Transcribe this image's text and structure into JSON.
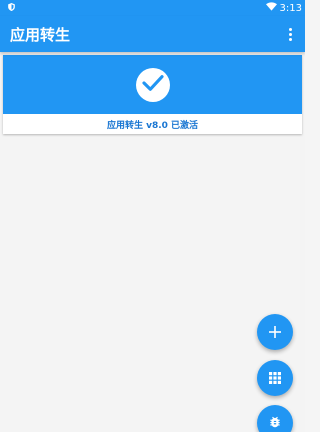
{
  "statusbar": {
    "time": "3:13"
  },
  "toolbar": {
    "title": "应用转生"
  },
  "card": {
    "status_text": "应用转生 v8.0 已激活"
  },
  "colors": {
    "primary": "#2196f3",
    "status_text": "#1976d2"
  },
  "icons": {
    "notification": "shield-notification-icon",
    "wifi": "wifi-icon",
    "menu": "more-vert-icon",
    "check": "check-icon",
    "fab_add": "plus-icon",
    "fab_apps": "grid-icon",
    "fab_bug": "bug-icon"
  }
}
